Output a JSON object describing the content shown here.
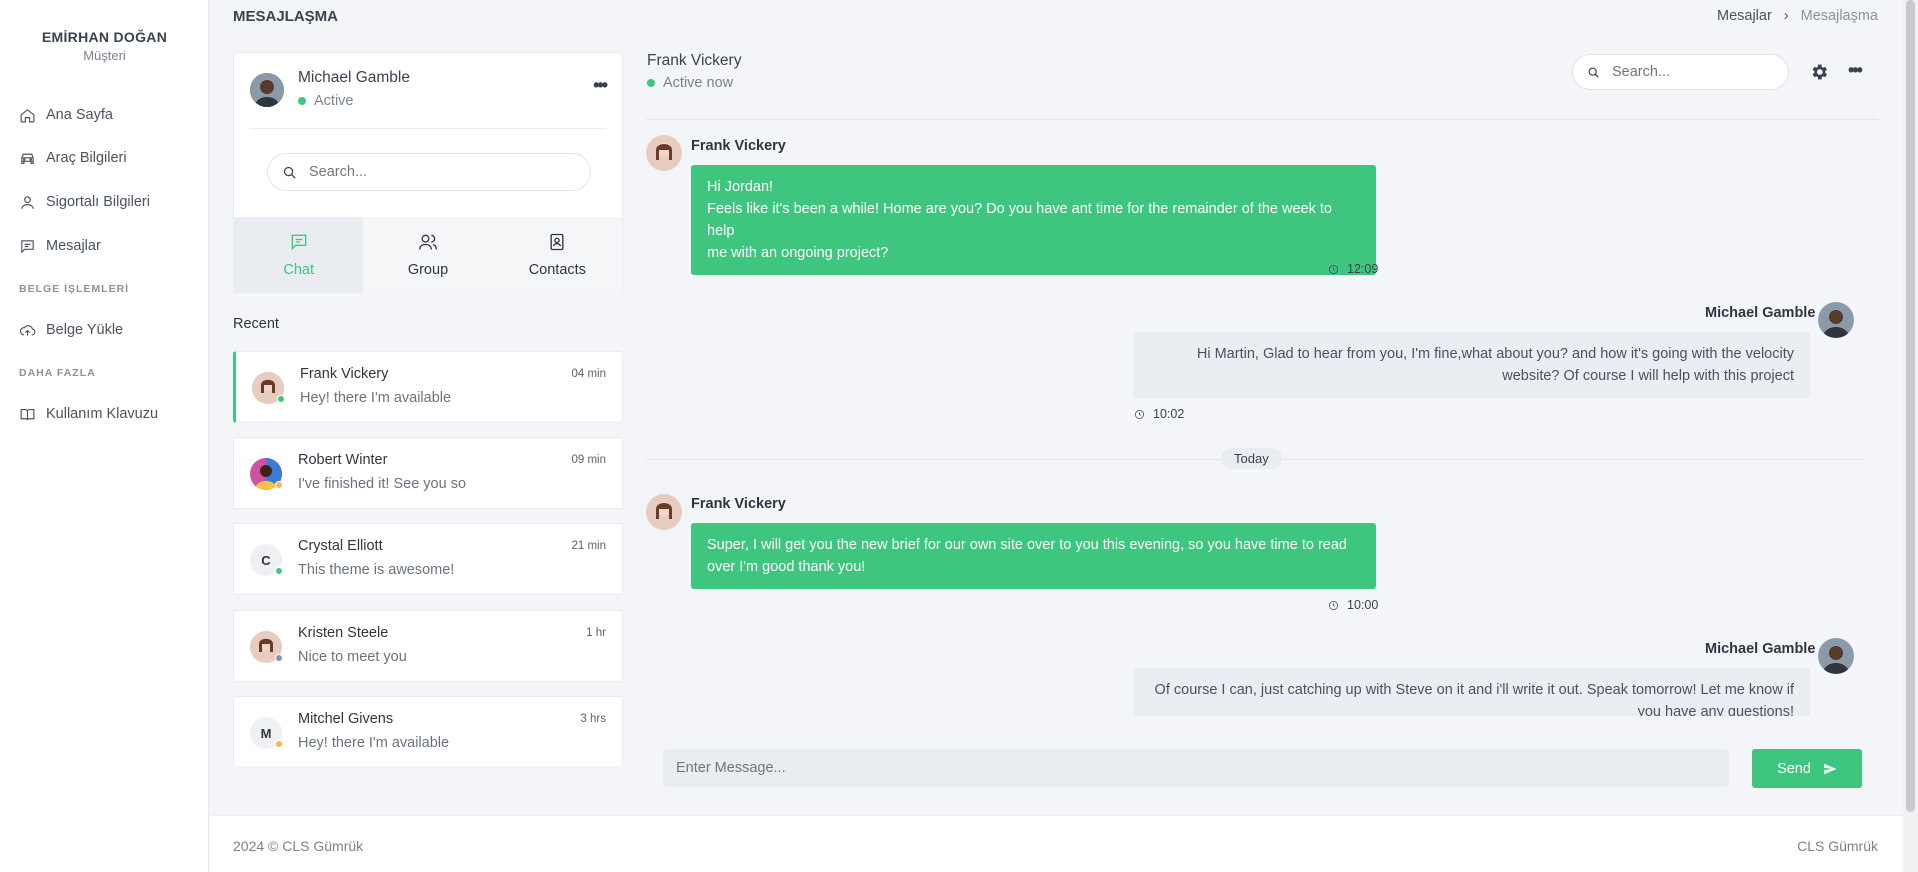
{
  "user": {
    "name": "EMİRHAN DOĞAN",
    "role": "Müşteri"
  },
  "sidebar": {
    "items": [
      {
        "label": "Ana Sayfa",
        "icon": "home-icon"
      },
      {
        "label": "Araç Bilgileri",
        "icon": "car-icon"
      },
      {
        "label": "Sigortalı Bilgileri",
        "icon": "user-icon"
      },
      {
        "label": "Mesajlar",
        "icon": "message-icon"
      }
    ],
    "section1": "BELGE İŞLEMLERİ",
    "upload": {
      "label": "Belge Yükle",
      "icon": "cloud-upload-icon"
    },
    "section2": "DAHA FAZLA",
    "guide": {
      "label": "Kullanım Klavuzu",
      "icon": "book-icon"
    }
  },
  "header": {
    "title": "MESAJLAŞMA",
    "breadcrumb": [
      "Mesajlar",
      "›",
      "Mesajlaşma"
    ]
  },
  "profile": {
    "name": "Michael Gamble",
    "status": "Active"
  },
  "search": {
    "placeholder": "Search..."
  },
  "tabs": [
    {
      "label": "Chat",
      "icon": "chat-icon",
      "active": true
    },
    {
      "label": "Group",
      "icon": "group-icon"
    },
    {
      "label": "Contacts",
      "icon": "contacts-icon"
    }
  ],
  "recent_title": "Recent",
  "conversations": [
    {
      "name": "Frank Vickery",
      "message": "Hey! there I'm available",
      "time": "04 min",
      "status_color": "#3ec57e"
    },
    {
      "name": "Robert Winter",
      "message": "I've finished it! See you so",
      "time": "09 min",
      "status_color": "#f7b84b"
    },
    {
      "name": "Crystal Elliott",
      "message": "This theme is awesome!",
      "time": "21 min",
      "initial": "C",
      "status_color": "#3ec57e"
    },
    {
      "name": "Kristen Steele",
      "message": "Nice to meet you",
      "time": "1 hr",
      "status_color": "#8a929e"
    },
    {
      "name": "Mitchel Givens",
      "message": "Hey! there I'm available",
      "time": "3 hrs",
      "initial": "M",
      "status_color": "#f7b84b"
    }
  ],
  "chat": {
    "peer_name": "Frank Vickery",
    "peer_status": "Active now",
    "search_placeholder": "Search...",
    "messages": [
      {
        "sender": "Frank Vickery",
        "lines": [
          "Hi Jordan!",
          "Feels like it's been a while! Home are you? Do you have ant time for the remainder of the week to help",
          "me with an ongoing project?"
        ],
        "time": "12:09"
      },
      {
        "sender": "Michael Gamble",
        "lines": [
          "Hi Martin, Glad to hear from you, I'm fine,what about you? and how it's going with the velocity",
          "website? Of course I will help with this project"
        ],
        "time": "10:02"
      },
      {
        "sender": "Frank Vickery",
        "lines": [
          "Super, I will get you the new brief for our own site over to you this evening, so you have time to read",
          "over I'm good thank you!"
        ],
        "time": "10:00"
      },
      {
        "sender": "Michael Gamble",
        "lines": [
          "Of course I can, just catching up with Steve on it and i'll write it out. Speak tomorrow! Let me know if",
          "you have any questions!"
        ]
      }
    ],
    "divider": "Today",
    "composer_placeholder": "Enter Message...",
    "send_label": "Send"
  },
  "footer": {
    "left": "2024 © CLS Gümrük",
    "right": "CLS Gümrük"
  },
  "colors": {
    "accent": "#3ec57e",
    "bubble_out": "#eaedf1"
  }
}
